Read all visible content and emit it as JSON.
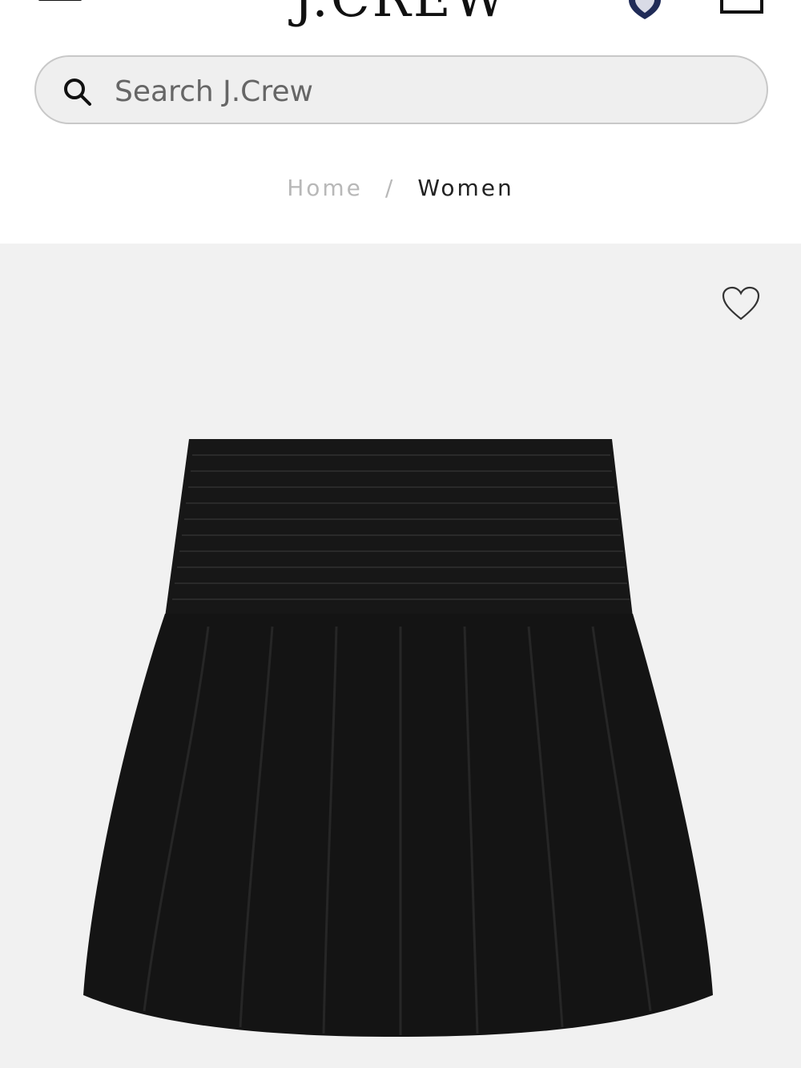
{
  "header": {
    "logo_text": "J.CREW",
    "menu_icon": "hamburger-menu-icon",
    "account_icon": "shield-icon",
    "bag_icon": "shopping-bag-icon",
    "accent_color": "#1f2b57"
  },
  "search": {
    "placeholder": "Search J.Crew",
    "icon": "search-icon"
  },
  "breadcrumb": {
    "home": "Home",
    "separator": "/",
    "current": "Women"
  },
  "product": {
    "wishlist_icon": "heart-outline-icon",
    "image_description_color": "#111111"
  }
}
